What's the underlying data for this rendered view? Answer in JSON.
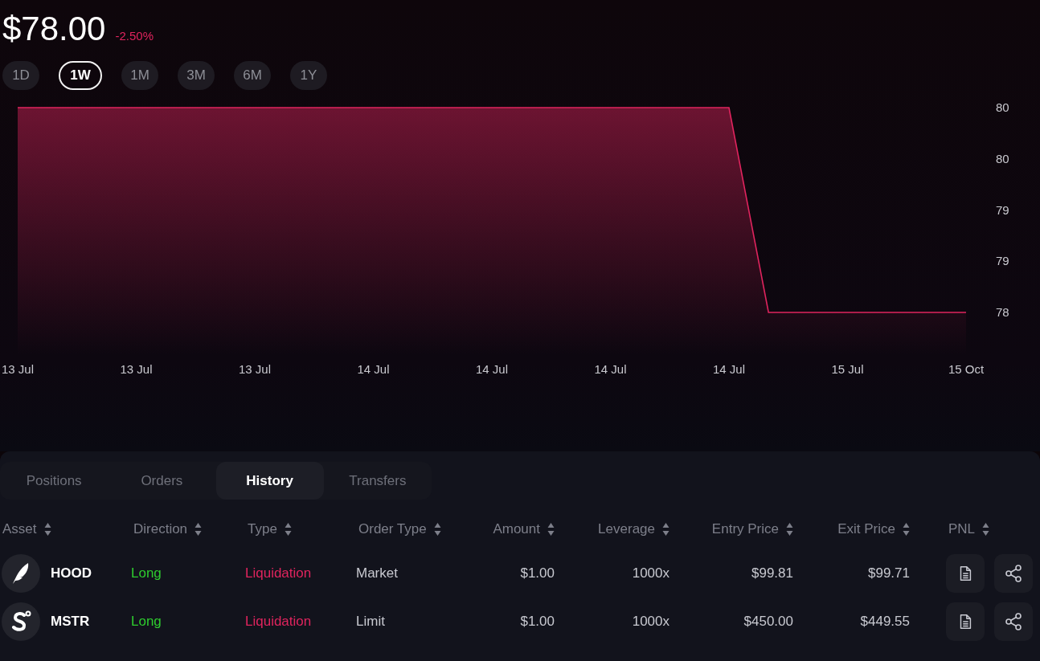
{
  "price": {
    "value": "$78.00",
    "change": "-2.50%"
  },
  "timeframes": [
    {
      "label": "1D",
      "selected": false
    },
    {
      "label": "1W",
      "selected": true
    },
    {
      "label": "1M",
      "selected": false
    },
    {
      "label": "3M",
      "selected": false
    },
    {
      "label": "6M",
      "selected": false
    },
    {
      "label": "1Y",
      "selected": false
    }
  ],
  "chart_data": {
    "type": "area",
    "categories": [
      "13 Jul",
      null,
      null,
      "13 Jul",
      null,
      null,
      "13 Jul",
      null,
      null,
      "14 Jul",
      null,
      null,
      "14 Jul",
      null,
      null,
      "14 Jul",
      null,
      null,
      "14 Jul",
      null,
      null,
      "15 Jul",
      null,
      null,
      "15 Oct"
    ],
    "series": [
      {
        "color": "#e0245e",
        "values": [
          80,
          80,
          80,
          80,
          80,
          80,
          80,
          80,
          80,
          80,
          80,
          80,
          80,
          80,
          80,
          80,
          80,
          80,
          80,
          78,
          78,
          78,
          78,
          78,
          78
        ]
      }
    ],
    "ylim": [
      78,
      80
    ],
    "yticks": [
      {
        "value": 80,
        "label": "80"
      },
      {
        "value": 79.5,
        "label": "80"
      },
      {
        "value": 79,
        "label": "79"
      },
      {
        "value": 78.5,
        "label": "79"
      },
      {
        "value": 78,
        "label": "78"
      }
    ]
  },
  "tabs": [
    {
      "label": "Positions",
      "selected": false
    },
    {
      "label": "Orders",
      "selected": false
    },
    {
      "label": "History",
      "selected": true
    },
    {
      "label": "Transfers",
      "selected": false
    }
  ],
  "table": {
    "columns": [
      "Asset",
      "Direction",
      "Type",
      "Order Type",
      "Amount",
      "Leverage",
      "Entry Price",
      "Exit Price",
      "PNL"
    ],
    "rows": [
      {
        "kind": "feather",
        "asset": "HOOD",
        "direction": "Long",
        "type": "Liquidation",
        "order_type": "Market",
        "amount": "$1.00",
        "leverage": "1000x",
        "entry_price": "$99.81",
        "exit_price": "$99.71"
      },
      {
        "kind": "letter-badge",
        "asset": "MSTR",
        "direction": "Long",
        "type": "Liquidation",
        "order_type": "Limit",
        "amount": "$1.00",
        "leverage": "1000x",
        "entry_price": "$450.00",
        "exit_price": "$449.55"
      }
    ]
  }
}
